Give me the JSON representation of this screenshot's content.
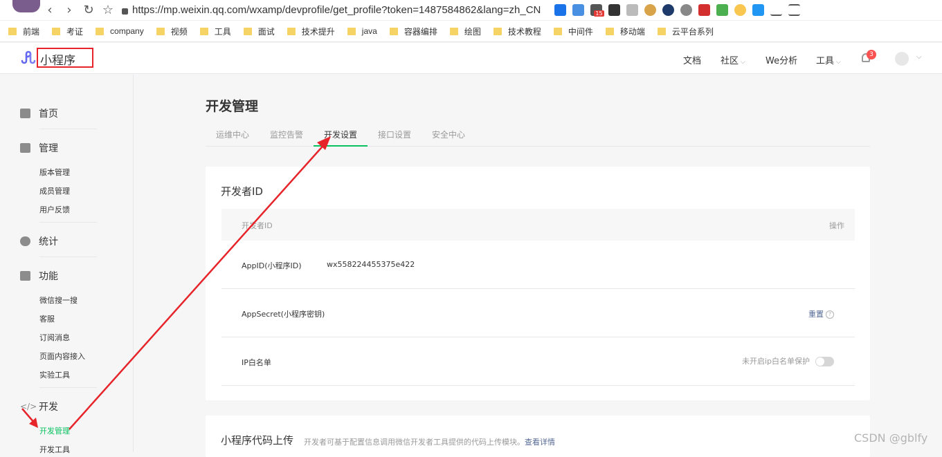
{
  "browser": {
    "url": "https://mp.weixin.qq.com/wxamp/devprofile/get_profile?token=1487584862&lang=zh_CN",
    "nav": {
      "back": "‹",
      "forward": "›",
      "reload": "↻",
      "star": "☆"
    },
    "extension_badge": "15",
    "bookmarks": [
      "前端",
      "考证",
      "company",
      "视频",
      "工具",
      "面试",
      "技术提升",
      "java",
      "容器编排",
      "绘图",
      "技术教程",
      "中间件",
      "移动端",
      "云平台系列"
    ]
  },
  "header": {
    "brand": "小程序",
    "nav": {
      "docs": "文档",
      "community": "社区",
      "analysis": "We分析",
      "tools": "工具"
    },
    "notification_count": "3",
    "highlight_color": "#e6242a"
  },
  "sidebar": {
    "home": "首页",
    "manage": {
      "title": "管理",
      "items": [
        "版本管理",
        "成员管理",
        "用户反馈"
      ]
    },
    "stats": "统计",
    "features": {
      "title": "功能",
      "items": [
        "微信搜一搜",
        "客服",
        "订阅消息",
        "页面内容接入",
        "实验工具"
      ]
    },
    "dev": {
      "title": "开发",
      "items": [
        "开发管理",
        "开发工具"
      ]
    },
    "active_color": "#07c160"
  },
  "main": {
    "title": "开发管理",
    "tabs": [
      "运维中心",
      "监控告警",
      "开发设置",
      "接口设置",
      "安全中心"
    ],
    "active_tab": "开发设置",
    "developer_id": {
      "title": "开发者ID",
      "columns": [
        "开发者ID",
        "操作"
      ],
      "rows": [
        {
          "label": "AppID(小程序ID)",
          "value": "wx558224455375e422",
          "action": ""
        },
        {
          "label": "AppSecret(小程序密钥)",
          "value": "",
          "action": "重置"
        },
        {
          "label": "IP白名单",
          "value": "",
          "action": "未开启ip白名单保护"
        }
      ]
    },
    "code_upload": {
      "title": "小程序代码上传",
      "desc": "开发者可基于配置信息调用微信开发者工具提供的代码上传模块。",
      "link": "查看详情"
    }
  },
  "watermark": "CSDN @gblfy",
  "annotation_color": "#e6242a"
}
